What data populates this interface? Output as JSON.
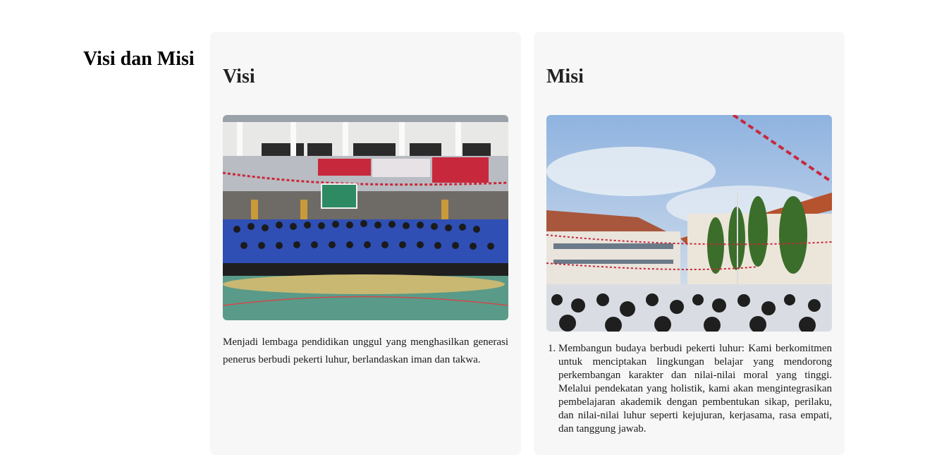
{
  "section_title": "Visi dan Misi",
  "visi": {
    "heading": "Visi",
    "image_alt": "school-group-photo",
    "text": "Menjadi lembaga pendidikan unggul yang menghasilkan generasi penerus berbudi pekerti luhur, berlandaskan iman dan takwa."
  },
  "misi": {
    "heading": "Misi",
    "image_alt": "school-ceremony-photo",
    "items": [
      "Membangun budaya berbudi pekerti luhur: Kami berkomitmen untuk menciptakan lingkungan belajar yang mendorong perkembangan karakter dan nilai-nilai moral yang tinggi. Melalui pendekatan yang holistik, kami akan mengintegrasikan pembelajaran akademik dengan pembentukan sikap, perilaku, dan nilai-nilai luhur seperti kejujuran, kerjasama, rasa empati, dan tanggung jawab."
    ]
  },
  "colors": {
    "card_bg": "#f7f7f7",
    "uniform_blue": "#2f4fb5",
    "banner_red": "#c8283c",
    "sky": "#8fb3e0"
  }
}
